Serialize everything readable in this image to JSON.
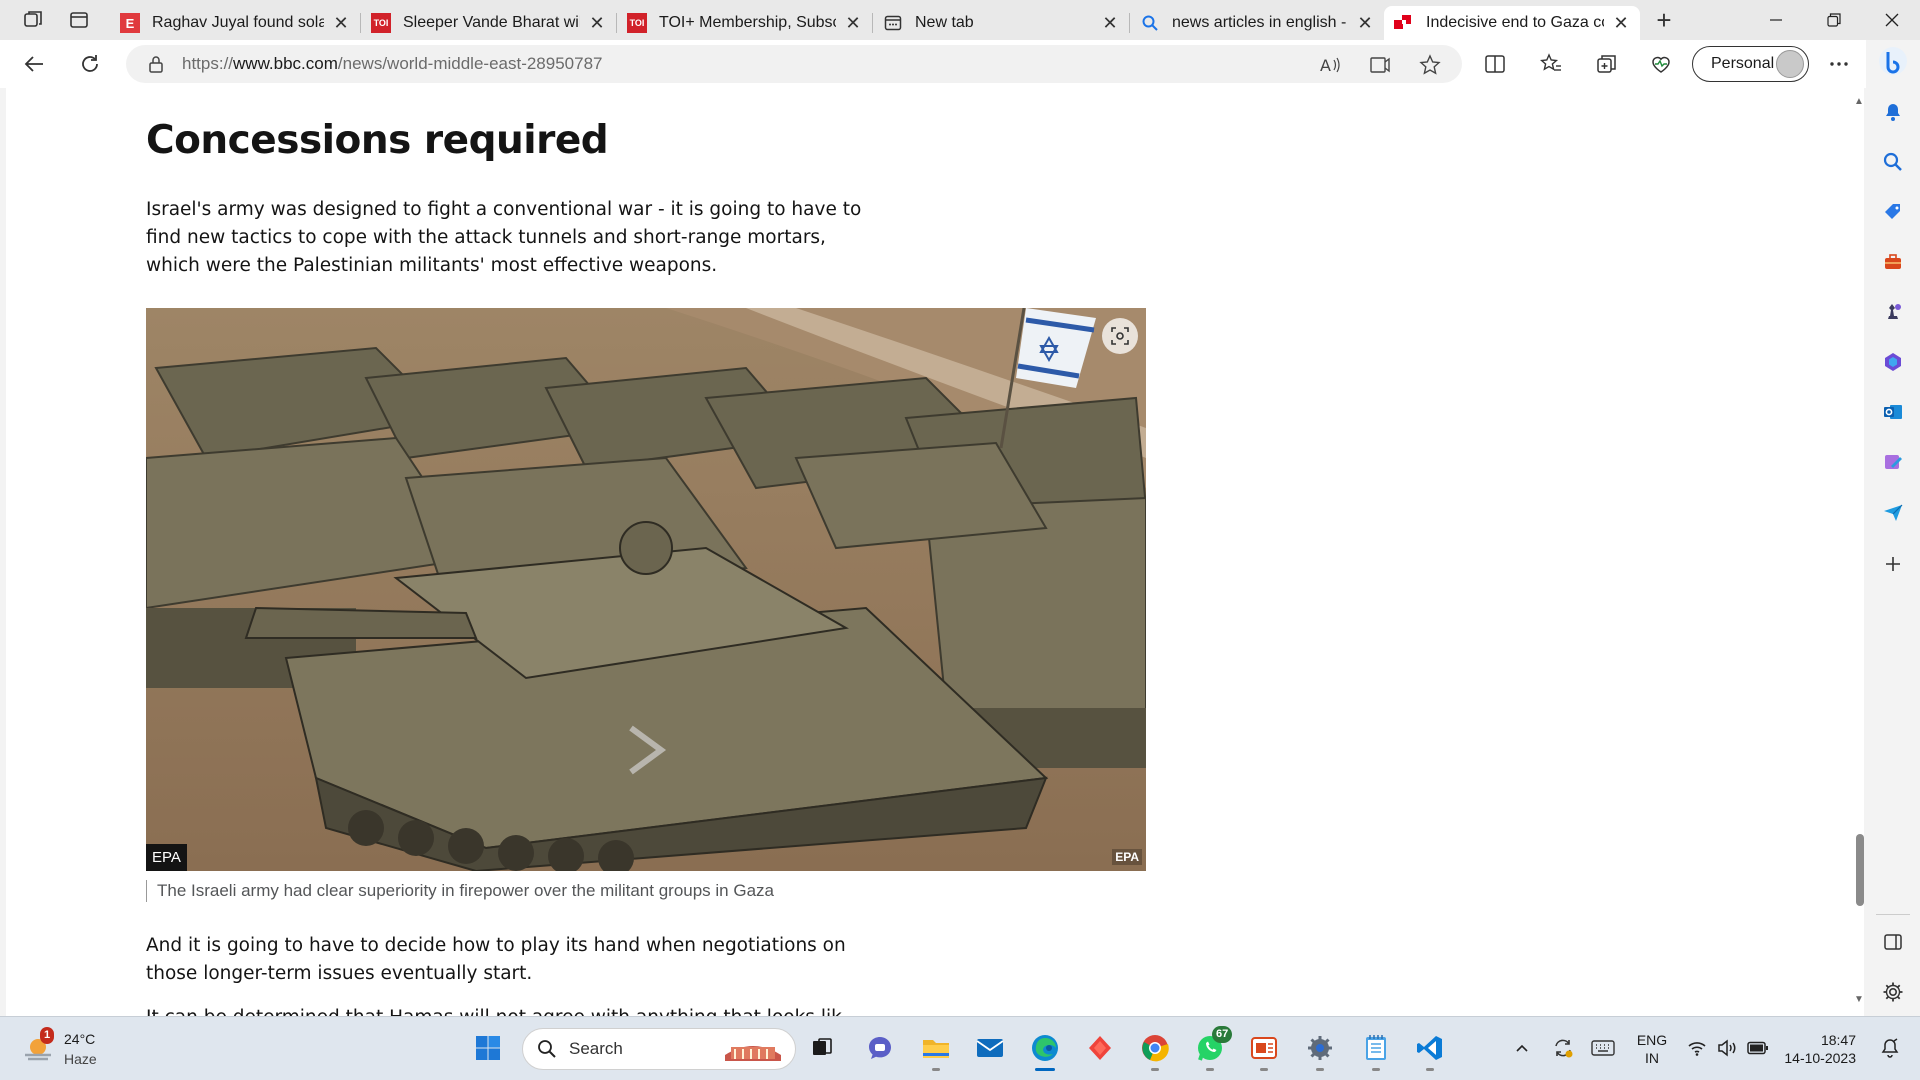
{
  "browser": {
    "tabs": [
      {
        "title": "Raghav Juyal found solace",
        "favicon_text": "E",
        "favicon_color": "#e03a3e"
      },
      {
        "title": "Sleeper Vande Bharat will c",
        "favicon_text": "TOI",
        "favicon_color": "#d1222a"
      },
      {
        "title": "TOI+ Membership, Subscri",
        "favicon_text": "TOI",
        "favicon_color": "#d1222a"
      },
      {
        "title": "New tab",
        "favicon_text": "",
        "favicon_color": "#333333"
      },
      {
        "title": "news articles in english - S",
        "favicon_text": "",
        "favicon_color": "#1a73e8"
      },
      {
        "title": "Indecisive end to Gaza con",
        "favicon_text": "",
        "favicon_color": "#e0001a"
      }
    ],
    "url_scheme": "https://",
    "url_domain": "www.bbc.com",
    "url_path": "/news/world-middle-east-28950787",
    "profile_label": "Personal"
  },
  "article": {
    "heading": "Concessions required",
    "paragraph1": "Israel's army was designed to fight a conventional war - it is going to have to find new tactics to cope with the attack tunnels and short-range mortars, which were the Palestinian militants' most effective weapons.",
    "image_credit": "EPA",
    "image_watermark": "EPA",
    "caption": "The Israeli army had clear superiority in firepower over the militant groups in Gaza",
    "paragraph2": "And it is going to have to decide how to play its hand when negotiations on those longer-term issues eventually start.",
    "paragraph3_partial": "It can be determined that Hamas will not agree with anything that looks lik"
  },
  "taskbar": {
    "weather_temp": "24°C",
    "weather_desc": "Haze",
    "weather_badge": "1",
    "search_label": "Search",
    "whatsapp_badge": "67",
    "lang_line1": "ENG",
    "lang_line2": "IN",
    "time": "18:47",
    "date": "14-10-2023"
  },
  "colors": {
    "accent": "#0067c0",
    "bbc_red": "#e0001a"
  }
}
